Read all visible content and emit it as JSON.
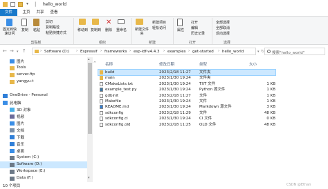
{
  "window": {
    "title": "hello_world"
  },
  "tabs": [
    "文件",
    "主页",
    "共享",
    "查看"
  ],
  "ribbon": {
    "clipboard": {
      "pin": "固定到快速访问",
      "copy": "复制",
      "paste": "粘贴",
      "cut": "剪切",
      "copy_path": "复制路径",
      "paste_shortcut": "粘贴快捷方式",
      "group": "剪贴板"
    },
    "organize": {
      "move_to": "移动到",
      "copy_to": "复制到",
      "delete": "删除",
      "rename": "重命名",
      "group": "组织"
    },
    "new": {
      "new_folder": "新建文件夹",
      "new_item": "新建项目",
      "easy_access": "轻松访问",
      "group": "新建"
    },
    "open": {
      "properties": "属性",
      "open": "打开",
      "edit": "编辑",
      "history": "历史记录",
      "group": "打开"
    },
    "select": {
      "select_all": "全部选择",
      "select_none": "全部取消",
      "invert": "反向选择",
      "group": "选择"
    }
  },
  "address": {
    "crumbs": [
      "Software (D:)",
      "Espressif",
      "frameworks",
      "esp-idf-v4.4.3",
      "examples",
      "get-started",
      "hello_world"
    ],
    "search_placeholder": "搜索\"hello_world\""
  },
  "sidebar": {
    "items": [
      {
        "label": "图片",
        "icon": "pictures-icon",
        "color": "#3a8ee6"
      },
      {
        "label": "Tools",
        "icon": "folder-icon",
        "color": "#e8b84a"
      },
      {
        "label": "server-ftp",
        "icon": "folder-icon",
        "color": "#e8b84a"
      },
      {
        "label": "yangyu-t",
        "icon": "folder-icon",
        "color": "#e8b84a"
      },
      {
        "label": "",
        "icon": "",
        "color": ""
      },
      {
        "label": "OneDrive - Personal",
        "icon": "onedrive-icon",
        "color": "#2f7fd8"
      },
      {
        "label": "此电脑",
        "icon": "pc-icon",
        "color": "#3a8ee6"
      },
      {
        "label": "3D 对象",
        "icon": "3d-objects-icon",
        "color": "#4ab0e8"
      },
      {
        "label": "视频",
        "icon": "videos-icon",
        "color": "#6b6b9a"
      },
      {
        "label": "图片",
        "icon": "pictures-icon",
        "color": "#3a8ee6"
      },
      {
        "label": "文档",
        "icon": "documents-icon",
        "color": "#7a8fa8"
      },
      {
        "label": "下载",
        "icon": "downloads-icon",
        "color": "#2f7fd8"
      },
      {
        "label": "音乐",
        "icon": "music-icon",
        "color": "#2f7fd8"
      },
      {
        "label": "桌面",
        "icon": "desktop-icon",
        "color": "#3a8ee6"
      },
      {
        "label": "System (C:)",
        "icon": "drive-icon",
        "color": "#6d7a88"
      },
      {
        "label": "Software (D:)",
        "icon": "drive-icon",
        "color": "#6d7a88"
      },
      {
        "label": "Workspace (E:)",
        "icon": "drive-icon",
        "color": "#6d7a88"
      },
      {
        "label": "Data (F:)",
        "icon": "drive-icon",
        "color": "#6d7a88"
      }
    ],
    "selected_index": 15
  },
  "columns": {
    "name": "名称",
    "date": "修改日期",
    "type": "类型",
    "size": "大小"
  },
  "files": [
    {
      "name": "build",
      "date": "2023/2/18 11:27",
      "type": "文件夹",
      "size": "",
      "icon": "folder-icon"
    },
    {
      "name": "main",
      "date": "2023/1/30 19:24",
      "type": "文件夹",
      "size": "",
      "icon": "folder-icon"
    },
    {
      "name": "CMakeLists.txt",
      "date": "2023/1/30 19:24",
      "type": "TXT 文件",
      "size": "1 KB",
      "icon": "text-file-icon"
    },
    {
      "name": "example_test.py",
      "date": "2023/1/30 19:24",
      "type": "Python 源文件",
      "size": "1 KB",
      "icon": "python-file-icon"
    },
    {
      "name": "gdbinit",
      "date": "2023/2/18 11:27",
      "type": "文件",
      "size": "1 KB",
      "icon": "file-icon"
    },
    {
      "name": "Makefile",
      "date": "2023/1/30 19:24",
      "type": "文件",
      "size": "1 KB",
      "icon": "file-icon"
    },
    {
      "name": "README.md",
      "date": "2023/1/30 19:24",
      "type": "Markdown 源文件",
      "size": "3 KB",
      "icon": "markdown-file-icon"
    },
    {
      "name": "sdkconfig",
      "date": "2023/2/18 11:29",
      "type": "文件",
      "size": "48 KB",
      "icon": "file-icon"
    },
    {
      "name": "sdkconfig.ci",
      "date": "2023/1/30 19:24",
      "type": "CI 文件",
      "size": "0 KB",
      "icon": "file-icon"
    },
    {
      "name": "sdkconfig.old",
      "date": "2023/2/18 11:25",
      "type": "OLD 文件",
      "size": "48 KB",
      "icon": "file-icon"
    }
  ],
  "files_selected_index": 0,
  "status": {
    "count": "10 个项目"
  },
  "watermark": "CSDN @Ethan"
}
